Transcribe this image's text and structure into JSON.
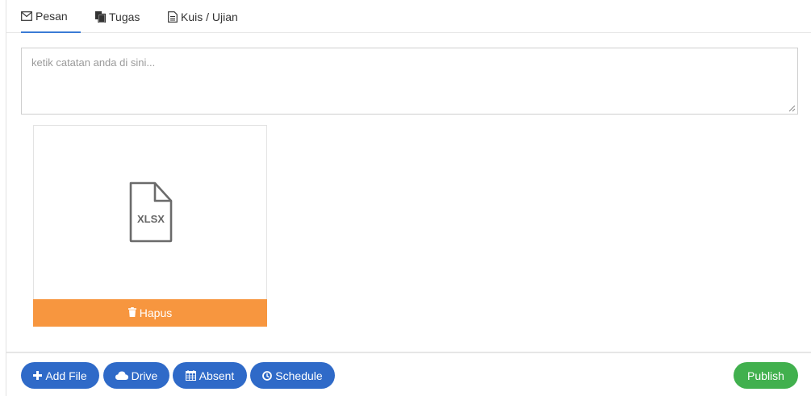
{
  "tabs": [
    {
      "label": "Pesan",
      "icon": "envelope-icon",
      "active": true
    },
    {
      "label": "Tugas",
      "icon": "copy-icon",
      "active": false
    },
    {
      "label": "Kuis / Ujian",
      "icon": "document-icon",
      "active": false
    }
  ],
  "note": {
    "placeholder": "ketik catatan anda di sini...",
    "value": ""
  },
  "attachment": {
    "file_type": "XLSX",
    "icon": "file-icon",
    "delete_label": "Hapus",
    "delete_icon": "trash-icon"
  },
  "toolbar": {
    "add_file": "Add File",
    "drive": "Drive",
    "absent": "Absent",
    "schedule": "Schedule",
    "publish": "Publish"
  },
  "colors": {
    "primary": "#2f6ac8",
    "publish": "#41b04e",
    "delete": "#f7963f",
    "active_tab": "#3a7bd5"
  }
}
